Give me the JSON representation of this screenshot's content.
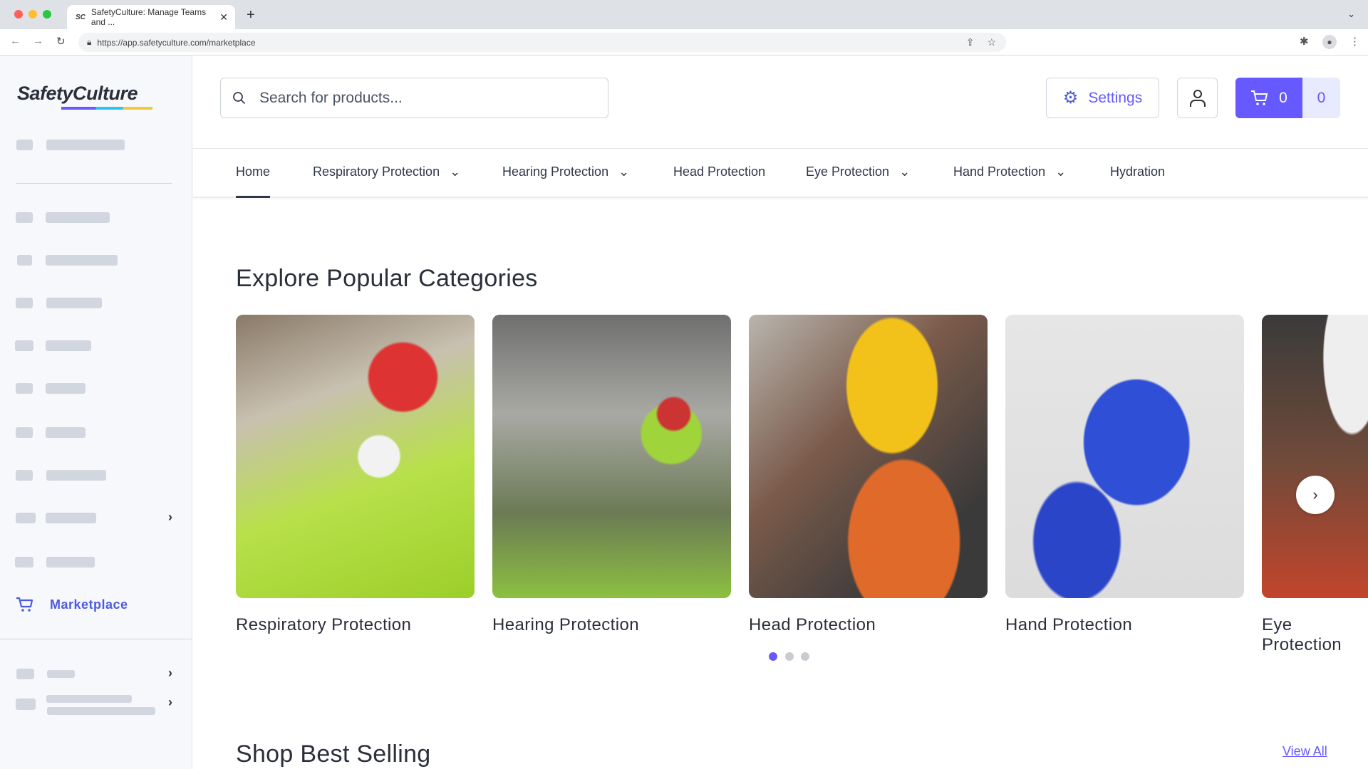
{
  "browser": {
    "tab_title": "SafetyCulture: Manage Teams and ...",
    "favicon": "SC",
    "url": "https://app.safetyculture.com/marketplace"
  },
  "sidebar": {
    "logo": "SafetyCulture",
    "marketplace_label": "Marketplace"
  },
  "header": {
    "search_placeholder": "Search for products...",
    "settings_label": "Settings",
    "cart_count": "0",
    "cart_total": "0"
  },
  "nav": [
    {
      "label": "Home",
      "active": true
    },
    {
      "label": "Respiratory Protection",
      "dropdown": true
    },
    {
      "label": "Hearing Protection",
      "dropdown": true
    },
    {
      "label": "Head Protection"
    },
    {
      "label": "Eye Protection",
      "dropdown": true
    },
    {
      "label": "Hand Protection",
      "dropdown": true
    },
    {
      "label": "Hydration"
    }
  ],
  "categories": {
    "title": "Explore Popular Categories",
    "items": [
      {
        "label": "Respiratory Protection"
      },
      {
        "label": "Hearing Protection"
      },
      {
        "label": "Head Protection"
      },
      {
        "label": "Hand Protection"
      },
      {
        "label": "Eye Protection"
      }
    ],
    "pagination": {
      "pages": 3,
      "current": 1
    }
  },
  "best_selling": {
    "title": "Shop Best Selling",
    "view_all": "View All"
  },
  "colors": {
    "accent": "#6559ff",
    "sidebar_active": "#4a5be0"
  }
}
